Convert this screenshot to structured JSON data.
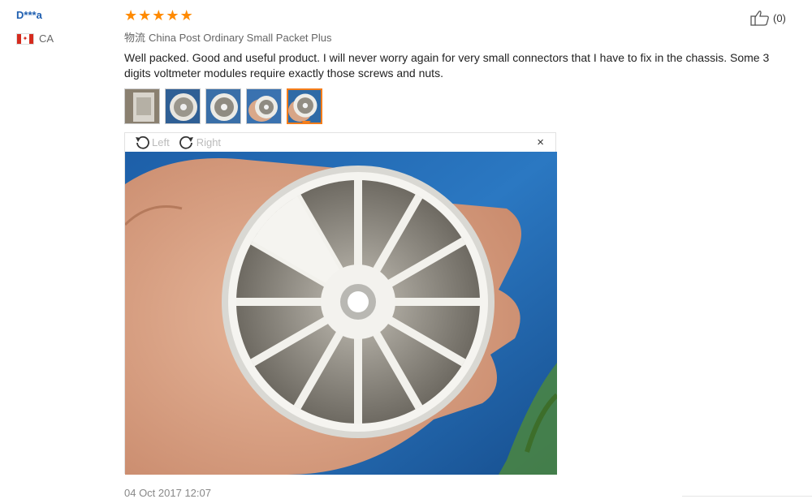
{
  "buyer": {
    "name": "D***a",
    "country": "CA",
    "flag": "canada-flag-icon"
  },
  "rating": {
    "stars": 5,
    "max": 5,
    "color": "#ff8a00"
  },
  "helpful": {
    "count_label": "(0)",
    "icon": "thumbs-up-icon"
  },
  "shipping": {
    "label": "物流",
    "method": "China Post Ordinary Small Packet Plus"
  },
  "review": {
    "text": "Well packed. Good and useful product. I will never worry again for very small connectors that I have to fix in the chassis. Some 3 digits voltmeter modules require exactly those screws and nuts."
  },
  "thumbnails": {
    "count": 5,
    "active_index": 4,
    "active_color": "#f47d1a"
  },
  "viewer": {
    "rotate_left": "Left",
    "rotate_right": "Right",
    "close": "×"
  },
  "date": "04 Oct 2017 12:07"
}
